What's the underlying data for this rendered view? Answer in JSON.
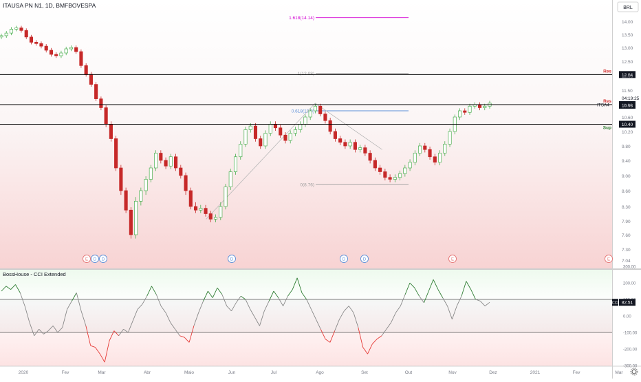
{
  "header": {
    "title": "ITAUSA PN N1, 1D, BMFBOVESPA",
    "currency": "BRL",
    "settings_icon": "gear-icon"
  },
  "colors": {
    "up": "#4caf50",
    "down": "#c62828",
    "support_resistance": "#000000",
    "fib_top": "#d200d2",
    "fib_mid": "#5b8fd8",
    "fib_base": "#9e9e9e",
    "zigzag": "#b8b8b8",
    "earnings": "#e57373",
    "dividend": "#5b8fd8",
    "cci_line": "#888888",
    "cci_high": "#2e7d32",
    "cci_low": "#e53935"
  },
  "chart_data": [
    {
      "type": "candlestick",
      "symbol": "ITSA4",
      "title": "ITAUSA PN N1, 1D, BMFBOVESPA",
      "y_axis_ticks": [
        7.04,
        7.3,
        7.6,
        7.9,
        8.3,
        8.6,
        9.0,
        9.4,
        9.8,
        10.2,
        10.6,
        11.0,
        11.5,
        12.0,
        12.5,
        13.0,
        13.5,
        14.0
      ],
      "ylim": [
        7.0,
        14.4
      ],
      "x_axis_labels": [
        "2020",
        "Fev",
        "Mar",
        "Abr",
        "Maio",
        "Jun",
        "Jul",
        "Ago",
        "Set",
        "Out",
        "Nov",
        "Dez",
        "2021",
        "Fev",
        "Mar"
      ],
      "price_series_close": [
        13.45,
        13.55,
        13.7,
        13.75,
        13.65,
        13.4,
        13.2,
        13.15,
        13.05,
        12.9,
        12.75,
        12.7,
        12.8,
        12.95,
        13.0,
        12.85,
        12.35,
        12.05,
        11.7,
        11.2,
        10.9,
        10.4,
        10.0,
        9.2,
        8.6,
        8.2,
        7.6,
        8.4,
        8.6,
        8.9,
        9.2,
        9.6,
        9.4,
        9.25,
        9.5,
        9.2,
        9.0,
        8.6,
        8.3,
        8.2,
        8.25,
        8.1,
        7.95,
        8.0,
        8.3,
        8.7,
        9.1,
        9.5,
        9.85,
        10.25,
        10.35,
        10.0,
        9.8,
        10.15,
        10.4,
        10.3,
        10.1,
        9.95,
        10.15,
        10.25,
        10.4,
        10.6,
        10.8,
        10.95,
        10.7,
        10.5,
        10.2,
        10.0,
        9.9,
        9.8,
        9.9,
        9.7,
        9.75,
        9.6,
        9.4,
        9.2,
        9.1,
        8.95,
        8.9,
        8.95,
        9.05,
        9.2,
        9.35,
        9.6,
        9.8,
        9.7,
        9.5,
        9.35,
        9.6,
        9.85,
        10.2,
        10.6,
        10.8,
        10.75,
        10.95,
        11.0,
        10.9,
        10.95,
        11.05
      ],
      "support_resistance": [
        {
          "label": "Res",
          "value": 12.04
        },
        {
          "label": "Res",
          "value": 11.0
        },
        {
          "label": "Sup",
          "value": 10.4
        }
      ],
      "price_labels": {
        "last_price": "10.98",
        "countdown": "04:19:25",
        "symbol_tag": "ITSA4"
      },
      "fib_levels": [
        {
          "label": "1.618(14.14)",
          "ratio": 1.618,
          "price": 14.14
        },
        {
          "label": "1(12.08)",
          "ratio": 1,
          "price": 12.08
        },
        {
          "label": "0.618(10.8)",
          "ratio": 0.618,
          "price": 10.8
        },
        {
          "label": "0(8.76)",
          "ratio": 0,
          "price": 8.76
        }
      ],
      "zigzag_points": [
        {
          "date": "Maio",
          "price": 7.95
        },
        {
          "date": "Jul",
          "price": 11.05
        },
        {
          "date": "Set",
          "price": 9.7
        }
      ],
      "event_markers": [
        {
          "label": "E",
          "type": "earnings",
          "month": "Fev"
        },
        {
          "label": "D",
          "type": "dividend",
          "month": "Fev"
        },
        {
          "label": "D",
          "type": "dividend",
          "month": "Mar"
        },
        {
          "label": "D",
          "type": "dividend",
          "month": "Jun"
        },
        {
          "label": "D",
          "type": "dividend",
          "month": "Ago"
        },
        {
          "label": "D",
          "type": "dividend",
          "month": "Set"
        },
        {
          "label": "E",
          "type": "earnings",
          "month": "Nov"
        },
        {
          "label": "E",
          "type": "earnings",
          "month": "Mar"
        }
      ]
    },
    {
      "type": "line",
      "title": "BossHouse - CCI Extended",
      "series_label": "CCI",
      "last_value": "82.51",
      "y_axis_ticks": [
        300,
        200,
        100,
        0,
        -100,
        -200,
        -300
      ],
      "ylim": [
        -320,
        320
      ],
      "levels": [
        100,
        -100
      ],
      "values": [
        150,
        180,
        160,
        190,
        140,
        60,
        -40,
        -120,
        -80,
        -110,
        -90,
        -60,
        -100,
        -70,
        40,
        90,
        140,
        30,
        -60,
        -180,
        -190,
        -230,
        -280,
        -150,
        -90,
        -120,
        -80,
        -100,
        -30,
        40,
        70,
        120,
        180,
        130,
        60,
        20,
        -40,
        -80,
        -120,
        -130,
        -160,
        -60,
        20,
        90,
        150,
        110,
        170,
        130,
        60,
        30,
        80,
        120,
        100,
        40,
        -10,
        -60,
        30,
        90,
        150,
        110,
        60,
        120,
        160,
        230,
        140,
        100,
        40,
        -20,
        -80,
        -140,
        -160,
        -90,
        -20,
        30,
        60,
        20,
        -70,
        -190,
        -230,
        -170,
        -140,
        -120,
        -80,
        -40,
        20,
        60,
        130,
        200,
        170,
        120,
        80,
        150,
        220,
        160,
        110,
        60,
        -20,
        60,
        120,
        210,
        160,
        100,
        90,
        60,
        82.51
      ]
    }
  ]
}
